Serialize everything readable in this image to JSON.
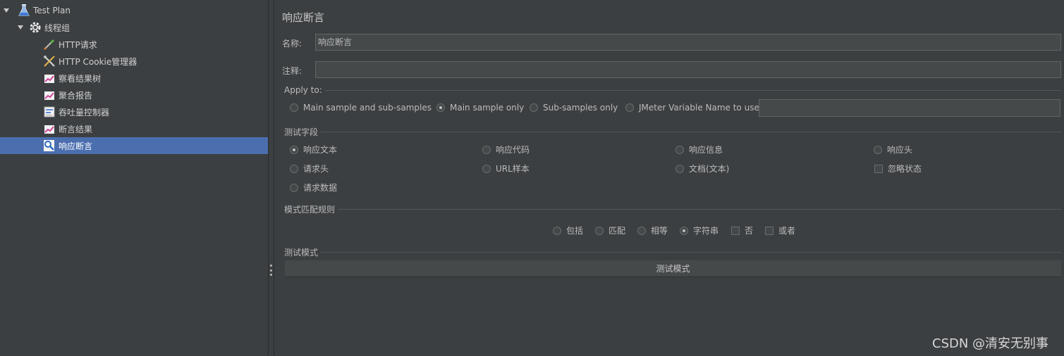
{
  "tree": {
    "nodes": [
      {
        "label": "Test Plan",
        "icon": "flask-icon"
      },
      {
        "label": "线程组",
        "icon": "gear-icon"
      },
      {
        "label": "HTTP请求",
        "icon": "pipette-icon"
      },
      {
        "label": "HTTP Cookie管理器",
        "icon": "tools-icon"
      },
      {
        "label": "察看结果树",
        "icon": "chart-icon"
      },
      {
        "label": "聚合报告",
        "icon": "chart-icon"
      },
      {
        "label": "吞吐量控制器",
        "icon": "controller-icon"
      },
      {
        "label": "断言结果",
        "icon": "chart-icon"
      },
      {
        "label": "响应断言",
        "icon": "magnifier-icon",
        "selected": true
      }
    ]
  },
  "panel": {
    "title": "响应断言",
    "name_label": "名称:",
    "name_value": "响应断言",
    "comment_label": "注释:",
    "comment_value": ""
  },
  "apply_to": {
    "title": "Apply to:",
    "options": [
      {
        "label": "Main sample and sub-samples",
        "checked": false
      },
      {
        "label": "Main sample only",
        "checked": true
      },
      {
        "label": "Sub-samples only",
        "checked": false
      },
      {
        "label": "JMeter Variable Name to use",
        "checked": false
      }
    ],
    "variable_value": ""
  },
  "test_field": {
    "title": "测试字段",
    "options": [
      {
        "label": "响应文本",
        "type": "radio",
        "checked": true
      },
      {
        "label": "响应代码",
        "type": "radio",
        "checked": false
      },
      {
        "label": "响应信息",
        "type": "radio",
        "checked": false
      },
      {
        "label": "响应头",
        "type": "radio",
        "checked": false
      },
      {
        "label": "请求头",
        "type": "radio",
        "checked": false
      },
      {
        "label": "URL样本",
        "type": "radio",
        "checked": false
      },
      {
        "label": "文档(文本)",
        "type": "radio",
        "checked": false
      },
      {
        "label": "忽略状态",
        "type": "checkbox",
        "checked": false
      },
      {
        "label": "请求数据",
        "type": "radio",
        "checked": false
      }
    ]
  },
  "pattern_rule": {
    "title": "模式匹配规则",
    "options": [
      {
        "label": "包括",
        "type": "radio",
        "checked": false
      },
      {
        "label": "匹配",
        "type": "radio",
        "checked": false
      },
      {
        "label": "相等",
        "type": "radio",
        "checked": false
      },
      {
        "label": "字符串",
        "type": "radio",
        "checked": true
      },
      {
        "label": "否",
        "type": "checkbox",
        "checked": false
      },
      {
        "label": "或者",
        "type": "checkbox",
        "checked": false
      }
    ]
  },
  "test_pattern": {
    "title": "测试模式",
    "header": "测试模式"
  },
  "watermark": "CSDN @清安无别事",
  "colors": {
    "background": "#3c3f41",
    "selection": "#4b6eaf",
    "input_bg": "#45494a"
  }
}
